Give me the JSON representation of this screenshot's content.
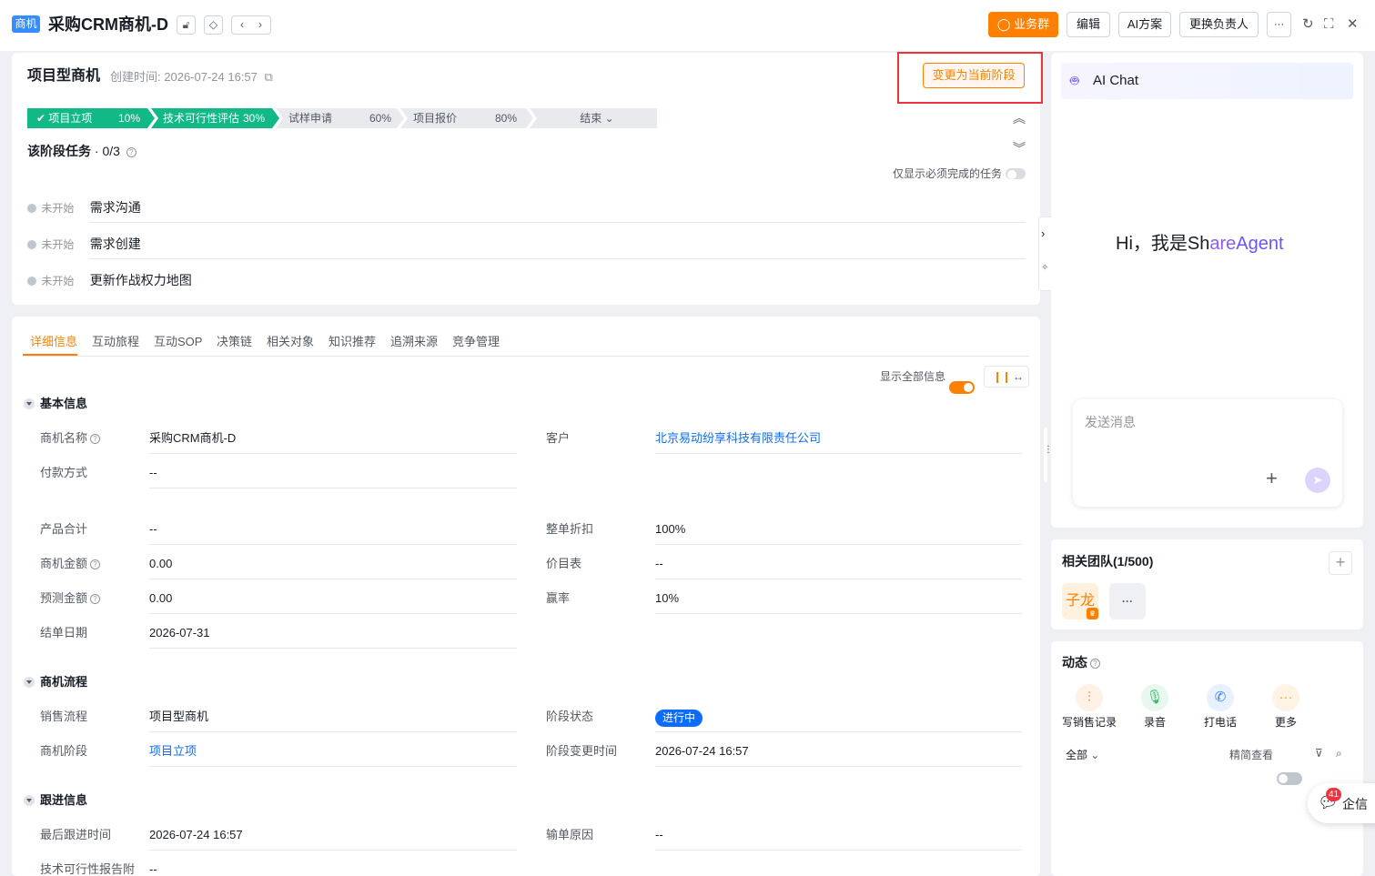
{
  "header": {
    "tag": "商机",
    "title": "采购CRM商机-D",
    "buttons": {
      "group": "业务群",
      "edit": "编辑",
      "ai_plan": "AI方案",
      "change_owner": "更换负责人",
      "more": "···"
    }
  },
  "stage_card": {
    "type_title": "项目型商机",
    "created_label": "创建时间:",
    "created_value": "2026-07-24 16:57",
    "change_stage_button": "变更为当前阶段",
    "stages": [
      {
        "name": "项目立项",
        "pct": "10%",
        "status": "done"
      },
      {
        "name": "技术可行性评估",
        "pct": "30%",
        "status": "current"
      },
      {
        "name": "试样申请",
        "pct": "60%",
        "status": "todo"
      },
      {
        "name": "项目报价",
        "pct": "80%",
        "status": "todo"
      },
      {
        "name": "结束",
        "pct": "",
        "status": "end"
      }
    ],
    "tasks_title": "该阶段任务",
    "tasks_count": "· 0/3",
    "only_required_label": "仅显示必须完成的任务",
    "tasks": [
      {
        "status": "未开始",
        "name": "需求沟通"
      },
      {
        "status": "未开始",
        "name": "需求创建"
      },
      {
        "status": "未开始",
        "name": "更新作战权力地图"
      }
    ]
  },
  "detail": {
    "tabs": [
      "详细信息",
      "互动旅程",
      "互动SOP",
      "决策链",
      "相关对象",
      "知识推荐",
      "追溯来源",
      "竞争管理"
    ],
    "show_all_label": "显示全部信息",
    "sections": {
      "basic": "基本信息",
      "flow": "商机流程",
      "follow": "跟进信息"
    },
    "fields": {
      "name_label": "商机名称",
      "name_value": "采购CRM商机-D",
      "customer_label": "客户",
      "customer_value": "北京易动纷享科技有限责任公司",
      "payment_label": "付款方式",
      "payment_value": "--",
      "product_total_label": "产品合计",
      "product_total_value": "--",
      "discount_label": "整单折扣",
      "discount_value": "100%",
      "amount_label": "商机金额",
      "amount_value": "0.00",
      "pricebook_label": "价目表",
      "pricebook_value": "--",
      "forecast_label": "预测金额",
      "forecast_value": "0.00",
      "winrate_label": "赢率",
      "winrate_value": "10%",
      "close_date_label": "结单日期",
      "close_date_value": "2026-07-31",
      "sales_flow_label": "销售流程",
      "sales_flow_value": "项目型商机",
      "stage_status_label": "阶段状态",
      "stage_status_value": "进行中",
      "stage_label": "商机阶段",
      "stage_value": "项目立项",
      "stage_change_label": "阶段变更时间",
      "stage_change_value": "2026-07-24 16:57",
      "last_follow_label": "最后跟进时间",
      "last_follow_value": "2026-07-24 16:57",
      "lost_reason_label": "输单原因",
      "lost_reason_value": "--",
      "tech_report_label": "技术可行性报告附",
      "tech_report_value": "--"
    }
  },
  "ai_chat": {
    "title": "AI Chat",
    "greeting_prefix": "Hi，我是Sh",
    "greeting_brand_a": "are",
    "greeting_brand_b": "Agent",
    "input_placeholder": "发送消息"
  },
  "team": {
    "title": "相关团队(1/500)",
    "member": "子龙",
    "more": "···"
  },
  "activity": {
    "title": "动态",
    "actions": [
      "写销售记录",
      "录音",
      "打电话",
      "更多"
    ],
    "filter_all": "全部",
    "compact_label": "精简查看"
  },
  "qixin": {
    "label": "企信",
    "badge": "41"
  },
  "colors": {
    "brand_orange": "#ff8000",
    "stage_green": "#12b886",
    "link_blue": "#0c6cff",
    "highlight_red": "#f0323c"
  }
}
